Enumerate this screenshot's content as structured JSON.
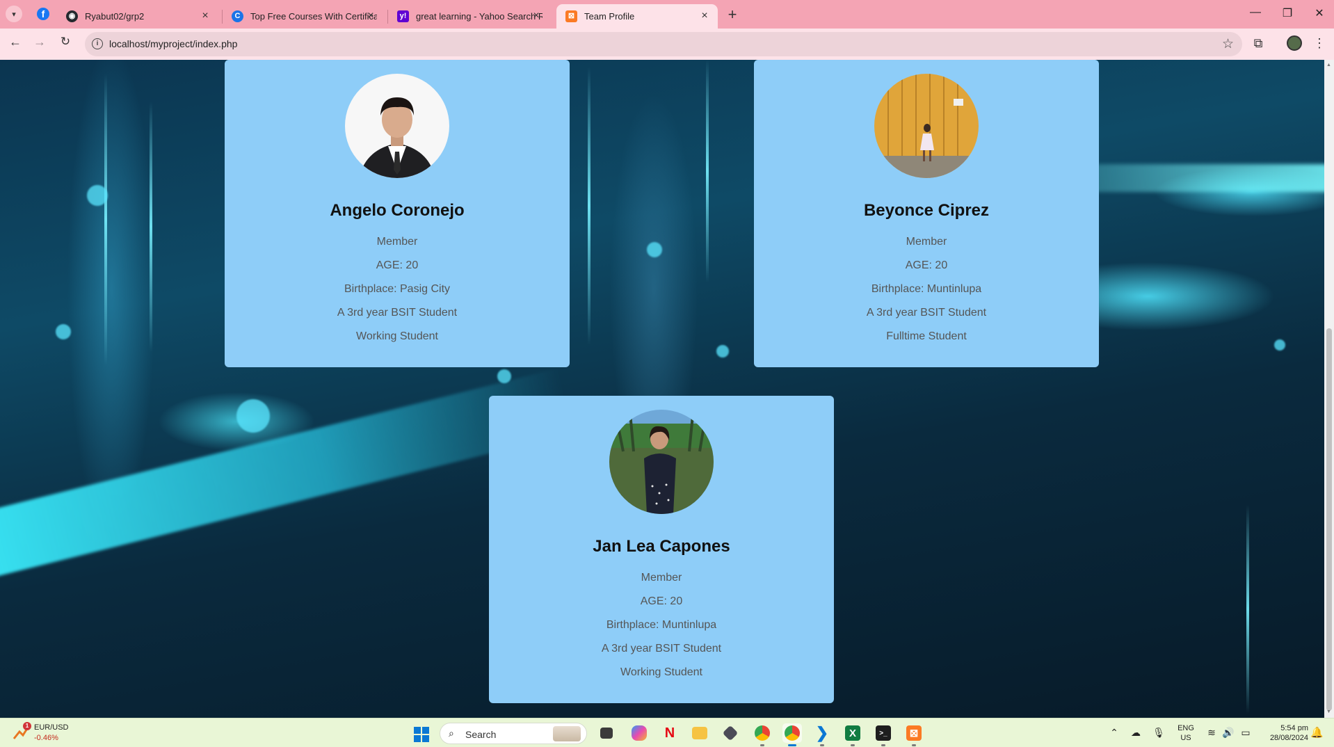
{
  "browser": {
    "tabs": [
      {
        "title": "Ryabut02/grp2",
        "icon": "github-icon"
      },
      {
        "title": "Top Free Courses With Certificate",
        "icon": "great-learning-icon"
      },
      {
        "title": "great learning - Yahoo Search Results",
        "icon": "yahoo-icon"
      },
      {
        "title": "Team Profile",
        "icon": "xampp-icon",
        "active": true
      }
    ],
    "url": "localhost/myproject/index.php"
  },
  "members": [
    {
      "name": "Angelo Coronejo",
      "role": "Member",
      "age": "AGE: 20",
      "birthplace": "Birthplace: Pasig City",
      "year": "A 3rd year BSIT Student",
      "status": "Working Student"
    },
    {
      "name": "Beyonce Ciprez",
      "role": "Member",
      "age": "AGE: 20",
      "birthplace": "Birthplace: Muntinlupa",
      "year": "A 3rd year BSIT Student",
      "status": "Fulltime Student"
    },
    {
      "name": "Jan Lea Capones",
      "role": "Member",
      "age": "AGE: 20",
      "birthplace": "Birthplace: Muntinlupa",
      "year": "A 3rd year BSIT Student",
      "status": "Working Student"
    }
  ],
  "taskbar": {
    "widget_pair": "EUR/USD",
    "widget_change": "-0.46%",
    "widget_badge": "1",
    "search_placeholder": "Search",
    "apps": [
      "file-explorer-icon",
      "copilot-icon",
      "netflix-icon",
      "folder-icon",
      "app-icon",
      "chrome-icon",
      "chrome-icon",
      "vscode-icon",
      "excel-icon",
      "terminal-icon",
      "xampp-icon"
    ],
    "lang_top": "ENG",
    "lang_bottom": "US",
    "time": "5:54 pm",
    "date": "28/08/2024"
  },
  "colors": {
    "card_bg": "#8ecdf8",
    "tabstrip_bg": "#f4a4b4",
    "toolbar_bg": "#fde2e8",
    "taskbar_bg": "#e9f6d6"
  }
}
